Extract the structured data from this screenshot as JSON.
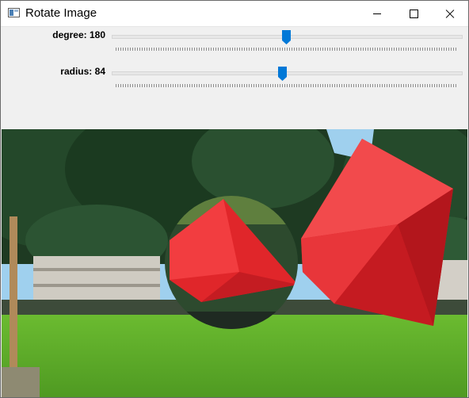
{
  "window": {
    "title": "Rotate Image"
  },
  "controls": {
    "degree": {
      "label": "degree: 180",
      "value": 180,
      "min": 0,
      "max": 360
    },
    "radius": {
      "label": "radius: 84",
      "value": 84,
      "min": 0,
      "max": 172
    }
  },
  "colors": {
    "accent": "#0078d7",
    "sculpture_red": "#e5262b",
    "grass": "#5fae2b",
    "sky": "#8fc8ec"
  },
  "icons": [
    "app-icon",
    "minimize-icon",
    "maximize-icon",
    "close-icon"
  ]
}
